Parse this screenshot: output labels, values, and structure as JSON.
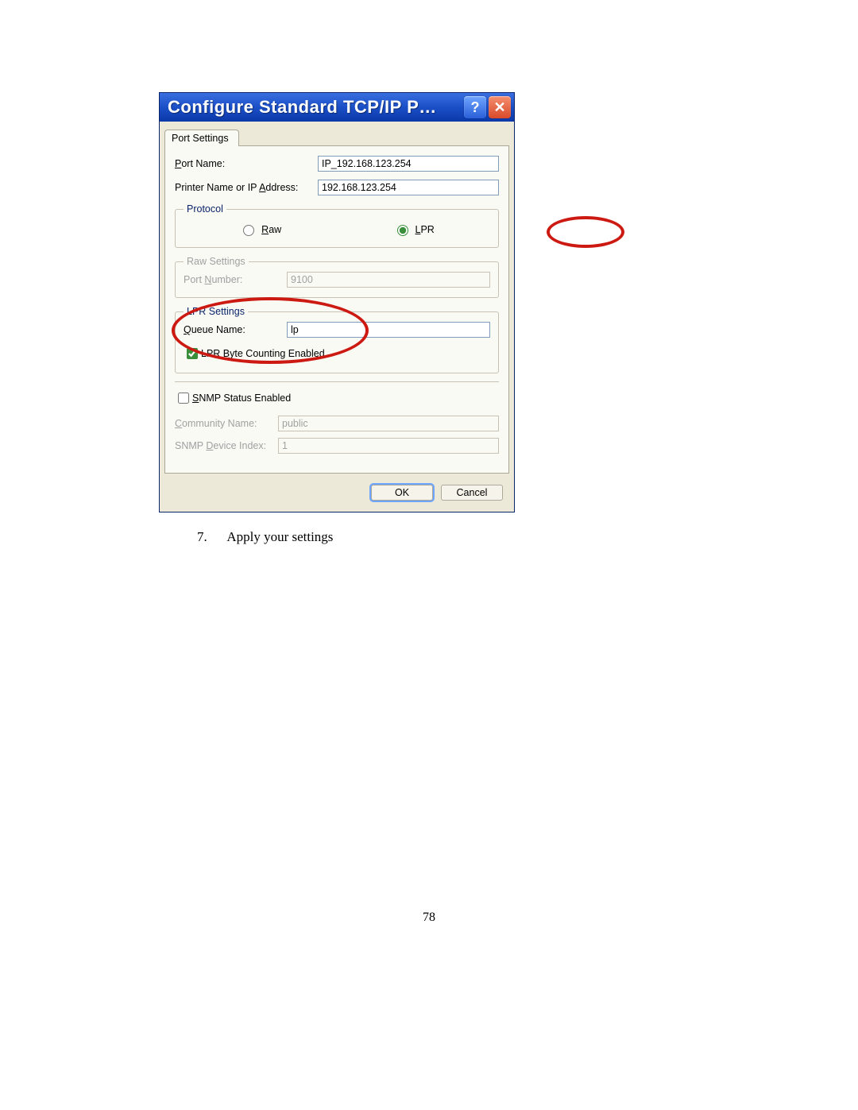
{
  "dialog": {
    "title": "Configure Standard TCP/IP P…",
    "tab_label": "Port Settings",
    "port_name_label": "Port Name:",
    "port_name_value": "IP_192.168.123.254",
    "printer_addr_label": "Printer Name or IP Address:",
    "printer_addr_value": "192.168.123.254",
    "protocol_legend": "Protocol",
    "radio_raw": "Raw",
    "radio_lpr": "LPR",
    "raw_legend": "Raw Settings",
    "raw_port_label": "Port Number:",
    "raw_port_value": "9100",
    "lpr_legend": "LPR Settings",
    "lpr_queue_label": "Queue Name:",
    "lpr_queue_value": "lp",
    "lpr_bytecount_label": "LPR Byte Counting Enabled",
    "snmp_chk_label": "SNMP Status Enabled",
    "snmp_comm_label": "Community Name:",
    "snmp_comm_value": "public",
    "snmp_idx_label": "SNMP Device Index:",
    "snmp_idx_value": "1",
    "ok_label": "OK",
    "cancel_label": "Cancel"
  },
  "instruction": {
    "number": "7.",
    "text": "Apply your settings"
  },
  "page_number": "78"
}
